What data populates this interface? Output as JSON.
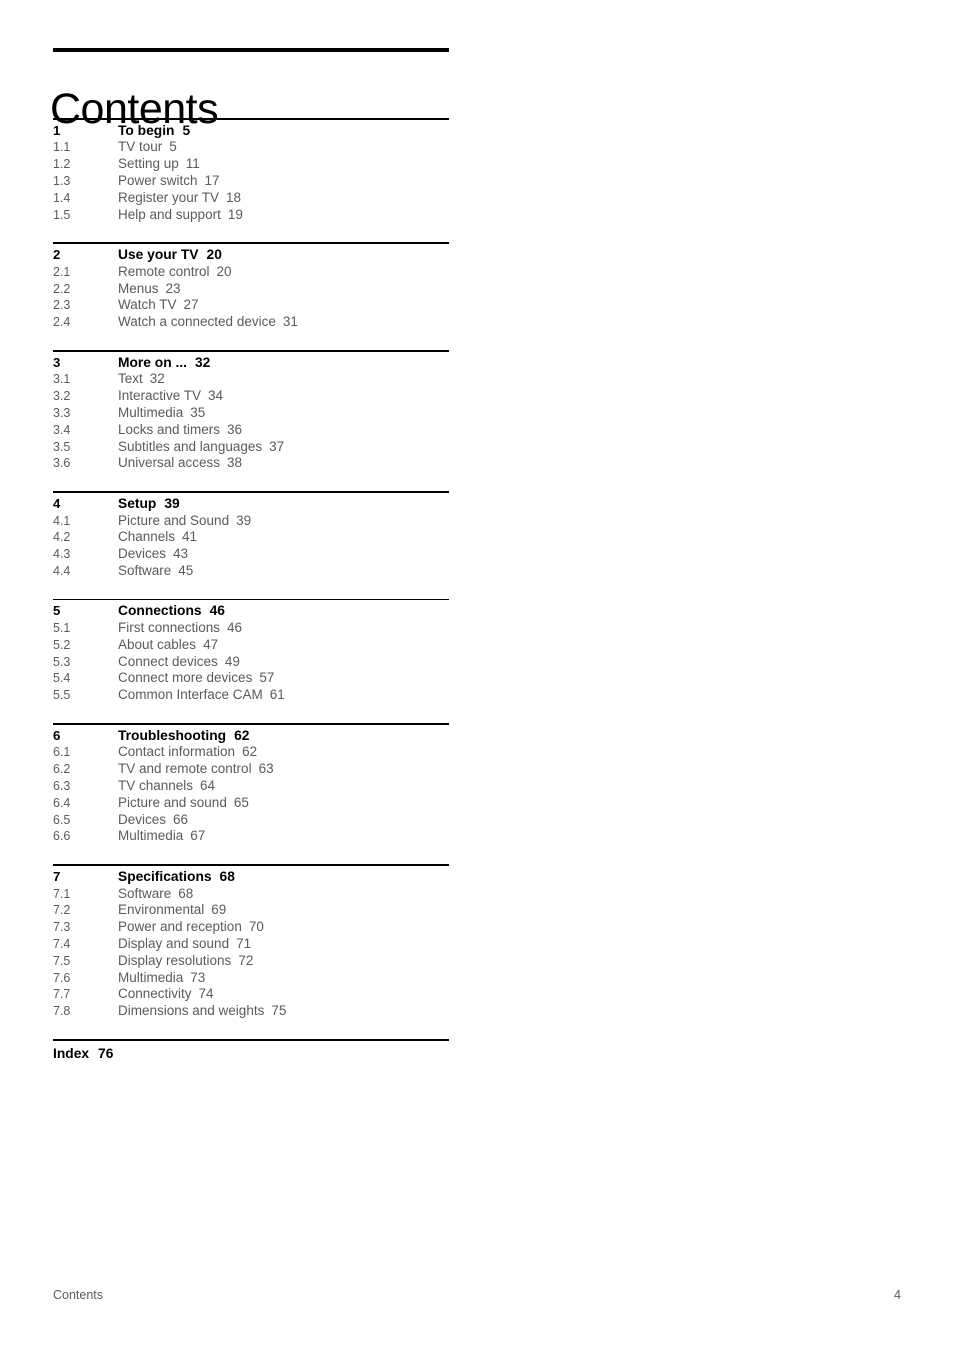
{
  "document": {
    "title": "Contents"
  },
  "toc": {
    "groups": [
      {
        "chapter": {
          "num": "1",
          "label": "To begin",
          "page": "5"
        },
        "entries": [
          {
            "num": "1.1",
            "label": "TV tour",
            "page": "5"
          },
          {
            "num": "1.2",
            "label": "Setting up",
            "page": "11"
          },
          {
            "num": "1.3",
            "label": "Power switch",
            "page": "17"
          },
          {
            "num": "1.4",
            "label": "Register your TV",
            "page": "18"
          },
          {
            "num": "1.5",
            "label": "Help and support",
            "page": "19"
          }
        ]
      },
      {
        "chapter": {
          "num": "2",
          "label": "Use your TV",
          "page": "20"
        },
        "entries": [
          {
            "num": "2.1",
            "label": "Remote control",
            "page": "20"
          },
          {
            "num": "2.2",
            "label": "Menus",
            "page": "23"
          },
          {
            "num": "2.3",
            "label": "Watch TV",
            "page": "27"
          },
          {
            "num": "2.4",
            "label": "Watch a connected device",
            "page": "31"
          }
        ]
      },
      {
        "chapter": {
          "num": "3",
          "label": "More on ...",
          "page": "32"
        },
        "entries": [
          {
            "num": "3.1",
            "label": "Text",
            "page": "32"
          },
          {
            "num": "3.2",
            "label": "Interactive TV",
            "page": "34"
          },
          {
            "num": "3.3",
            "label": "Multimedia",
            "page": "35"
          },
          {
            "num": "3.4",
            "label": "Locks and timers",
            "page": "36"
          },
          {
            "num": "3.5",
            "label": "Subtitles and languages",
            "page": "37"
          },
          {
            "num": "3.6",
            "label": "Universal access",
            "page": "38"
          }
        ]
      },
      {
        "chapter": {
          "num": "4",
          "label": "Setup",
          "page": "39"
        },
        "entries": [
          {
            "num": "4.1",
            "label": "Picture and Sound",
            "page": "39"
          },
          {
            "num": "4.2",
            "label": "Channels",
            "page": "41"
          },
          {
            "num": "4.3",
            "label": "Devices",
            "page": "43"
          },
          {
            "num": "4.4",
            "label": "Software",
            "page": "45"
          }
        ]
      },
      {
        "chapter": {
          "num": "5",
          "label": "Connections",
          "page": "46"
        },
        "entries": [
          {
            "num": "5.1",
            "label": "First connections",
            "page": "46"
          },
          {
            "num": "5.2",
            "label": "About cables",
            "page": "47"
          },
          {
            "num": "5.3",
            "label": "Connect devices",
            "page": "49"
          },
          {
            "num": "5.4",
            "label": "Connect more devices",
            "page": "57"
          },
          {
            "num": "5.5",
            "label": "Common Interface CAM",
            "page": "61"
          }
        ]
      },
      {
        "chapter": {
          "num": "6",
          "label": "Troubleshooting",
          "page": "62"
        },
        "entries": [
          {
            "num": "6.1",
            "label": "Contact information",
            "page": "62"
          },
          {
            "num": "6.2",
            "label": "TV and remote control",
            "page": "63"
          },
          {
            "num": "6.3",
            "label": "TV channels",
            "page": "64"
          },
          {
            "num": "6.4",
            "label": "Picture and sound",
            "page": "65"
          },
          {
            "num": "6.5",
            "label": "Devices",
            "page": "66"
          },
          {
            "num": "6.6",
            "label": "Multimedia",
            "page": "67"
          }
        ]
      },
      {
        "chapter": {
          "num": "7",
          "label": "Specifications",
          "page": "68"
        },
        "entries": [
          {
            "num": "7.1",
            "label": "Software",
            "page": "68"
          },
          {
            "num": "7.2",
            "label": "Environmental",
            "page": "69"
          },
          {
            "num": "7.3",
            "label": "Power and reception",
            "page": "70"
          },
          {
            "num": "7.4",
            "label": "Display and sound",
            "page": "71"
          },
          {
            "num": "7.5",
            "label": "Display resolutions",
            "page": "72"
          },
          {
            "num": "7.6",
            "label": "Multimedia",
            "page": "73"
          },
          {
            "num": "7.7",
            "label": "Connectivity",
            "page": "74"
          },
          {
            "num": "7.8",
            "label": "Dimensions and weights",
            "page": "75"
          }
        ]
      }
    ],
    "index": {
      "label": "Index",
      "page": "76"
    }
  },
  "footer": {
    "left": "Contents",
    "page_number": "4"
  },
  "colors": {
    "text_primary": "#000000",
    "text_secondary": "#5b5b5b",
    "rule": "#000000",
    "background": "#ffffff"
  }
}
